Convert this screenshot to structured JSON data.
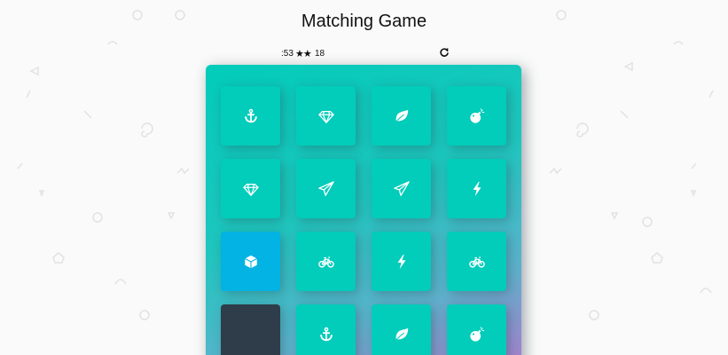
{
  "title": "Matching Game",
  "score_panel": {
    "timer": ":53",
    "stars_shown": 2,
    "moves": "18",
    "restart_icon": "rotate-icon"
  },
  "colors": {
    "card_match": "#02ccba",
    "card_open": "#02b3e4",
    "card_closed": "#2e3d49",
    "deck_gradient_start": "#02ccba",
    "deck_gradient_end": "#aa7ecd"
  },
  "deck": {
    "rows": [
      [
        {
          "icon": "anchor",
          "state": "match"
        },
        {
          "icon": "diamond",
          "state": "match"
        },
        {
          "icon": "leaf",
          "state": "match"
        },
        {
          "icon": "bomb",
          "state": "match"
        }
      ],
      [
        {
          "icon": "diamond",
          "state": "match"
        },
        {
          "icon": "paper-plane",
          "state": "match"
        },
        {
          "icon": "paper-plane",
          "state": "match"
        },
        {
          "icon": "bolt",
          "state": "match"
        }
      ],
      [
        {
          "icon": "cube",
          "state": "open"
        },
        {
          "icon": "bicycle",
          "state": "match"
        },
        {
          "icon": "bolt",
          "state": "match"
        },
        {
          "icon": "bicycle",
          "state": "match"
        }
      ],
      [
        {
          "icon": "",
          "state": "closed"
        },
        {
          "icon": "anchor",
          "state": "match"
        },
        {
          "icon": "leaf",
          "state": "match"
        },
        {
          "icon": "bomb",
          "state": "match"
        }
      ]
    ]
  }
}
